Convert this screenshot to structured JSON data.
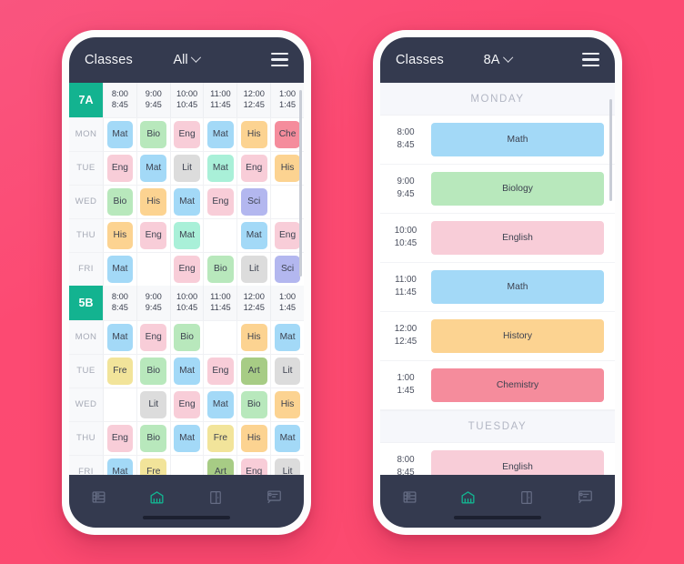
{
  "theme": {
    "background_start": "#f9557f",
    "background_end": "#fc4a6e",
    "topbar_color": "#343a4f",
    "accent_teal": "#13b390",
    "badge_color": "#13b390"
  },
  "subject_colors": {
    "Mat": "#a3d9f7",
    "Math": "#a3d9f7",
    "Bio": "#b8e8bc",
    "Biology": "#b8e8bc",
    "Eng": "#f8cdd8",
    "English": "#f8cdd8",
    "His": "#fcd391",
    "History": "#fcd391",
    "Che": "#f58c9c",
    "Chemistry": "#f58c9c",
    "Lit": "#dcdcdc",
    "Sci": "#b3b7ef",
    "Fre": "#f2e49a",
    "Art": "#a7cc85",
    "MatAlt": "#a9f0d8"
  },
  "phones": [
    {
      "id": "phone-grid",
      "topbar": {
        "title": "Classes",
        "selected_class": "All",
        "menu_icon": "hamburger-icon",
        "caret_icon": "chevron-down-icon"
      },
      "view": "grid",
      "blocks": [
        {
          "badge": "7A",
          "times": [
            {
              "start": "8:00",
              "end": "8:45"
            },
            {
              "start": "9:00",
              "end": "9:45"
            },
            {
              "start": "10:00",
              "end": "10:45"
            },
            {
              "start": "11:00",
              "end": "11:45"
            },
            {
              "start": "12:00",
              "end": "12:45"
            },
            {
              "start": "1:00",
              "end": "1:45"
            }
          ],
          "rows": [
            {
              "day": "MON",
              "slots": [
                {
                  "label": "Mat",
                  "color": "#a3d9f7"
                },
                {
                  "label": "Bio",
                  "color": "#b8e8bc"
                },
                {
                  "label": "Eng",
                  "color": "#f8cdd8"
                },
                {
                  "label": "Mat",
                  "color": "#a3d9f7"
                },
                {
                  "label": "His",
                  "color": "#fcd391"
                },
                {
                  "label": "Che",
                  "color": "#f58c9c"
                }
              ]
            },
            {
              "day": "TUE",
              "slots": [
                {
                  "label": "Eng",
                  "color": "#f8cdd8"
                },
                {
                  "label": "Mat",
                  "color": "#a3d9f7"
                },
                {
                  "label": "Lit",
                  "color": "#dcdcdc"
                },
                {
                  "label": "Mat",
                  "color": "#a9f0d8"
                },
                {
                  "label": "Eng",
                  "color": "#f8cdd8"
                },
                {
                  "label": "His",
                  "color": "#fcd391"
                }
              ]
            },
            {
              "day": "WED",
              "slots": [
                {
                  "label": "Bio",
                  "color": "#b8e8bc"
                },
                {
                  "label": "His",
                  "color": "#fcd391"
                },
                {
                  "label": "Mat",
                  "color": "#a3d9f7"
                },
                {
                  "label": "Eng",
                  "color": "#f8cdd8"
                },
                {
                  "label": "Sci",
                  "color": "#b3b7ef"
                },
                {
                  "label": "",
                  "color": ""
                }
              ]
            },
            {
              "day": "THU",
              "slots": [
                {
                  "label": "His",
                  "color": "#fcd391"
                },
                {
                  "label": "Eng",
                  "color": "#f8cdd8"
                },
                {
                  "label": "Mat",
                  "color": "#a9f0d8"
                },
                {
                  "label": "",
                  "color": ""
                },
                {
                  "label": "Mat",
                  "color": "#a3d9f7"
                },
                {
                  "label": "Eng",
                  "color": "#f8cdd8"
                }
              ]
            },
            {
              "day": "FRI",
              "slots": [
                {
                  "label": "Mat",
                  "color": "#a3d9f7"
                },
                {
                  "label": "",
                  "color": ""
                },
                {
                  "label": "Eng",
                  "color": "#f8cdd8"
                },
                {
                  "label": "Bio",
                  "color": "#b8e8bc"
                },
                {
                  "label": "Lit",
                  "color": "#dcdcdc"
                },
                {
                  "label": "Sci",
                  "color": "#b3b7ef"
                }
              ]
            }
          ]
        },
        {
          "badge": "5B",
          "times": [
            {
              "start": "8:00",
              "end": "8:45"
            },
            {
              "start": "9:00",
              "end": "9:45"
            },
            {
              "start": "10:00",
              "end": "10:45"
            },
            {
              "start": "11:00",
              "end": "11:45"
            },
            {
              "start": "12:00",
              "end": "12:45"
            },
            {
              "start": "1:00",
              "end": "1:45"
            }
          ],
          "rows": [
            {
              "day": "MON",
              "slots": [
                {
                  "label": "Mat",
                  "color": "#a3d9f7"
                },
                {
                  "label": "Eng",
                  "color": "#f8cdd8"
                },
                {
                  "label": "Bio",
                  "color": "#b8e8bc"
                },
                {
                  "label": "",
                  "color": ""
                },
                {
                  "label": "His",
                  "color": "#fcd391"
                },
                {
                  "label": "Mat",
                  "color": "#a3d9f7"
                }
              ]
            },
            {
              "day": "TUE",
              "slots": [
                {
                  "label": "Fre",
                  "color": "#f2e49a"
                },
                {
                  "label": "Bio",
                  "color": "#b8e8bc"
                },
                {
                  "label": "Mat",
                  "color": "#a3d9f7"
                },
                {
                  "label": "Eng",
                  "color": "#f8cdd8"
                },
                {
                  "label": "Art",
                  "color": "#a7cc85"
                },
                {
                  "label": "Lit",
                  "color": "#dcdcdc"
                }
              ]
            },
            {
              "day": "WED",
              "slots": [
                {
                  "label": "",
                  "color": ""
                },
                {
                  "label": "Lit",
                  "color": "#dcdcdc"
                },
                {
                  "label": "Eng",
                  "color": "#f8cdd8"
                },
                {
                  "label": "Mat",
                  "color": "#a3d9f7"
                },
                {
                  "label": "Bio",
                  "color": "#b8e8bc"
                },
                {
                  "label": "His",
                  "color": "#fcd391"
                }
              ]
            },
            {
              "day": "THU",
              "slots": [
                {
                  "label": "Eng",
                  "color": "#f8cdd8"
                },
                {
                  "label": "Bio",
                  "color": "#b8e8bc"
                },
                {
                  "label": "Mat",
                  "color": "#a3d9f7"
                },
                {
                  "label": "Fre",
                  "color": "#f2e49a"
                },
                {
                  "label": "His",
                  "color": "#fcd391"
                },
                {
                  "label": "Mat",
                  "color": "#a3d9f7"
                }
              ]
            },
            {
              "day": "FRI",
              "slots": [
                {
                  "label": "Mat",
                  "color": "#a3d9f7"
                },
                {
                  "label": "Fre",
                  "color": "#f2e49a"
                },
                {
                  "label": "",
                  "color": ""
                },
                {
                  "label": "Art",
                  "color": "#a7cc85"
                },
                {
                  "label": "Eng",
                  "color": "#f8cdd8"
                },
                {
                  "label": "Lit",
                  "color": "#dcdcdc"
                }
              ]
            }
          ]
        }
      ],
      "nav": [
        {
          "icon": "books-icon",
          "active": false
        },
        {
          "icon": "school-building-icon",
          "active": true
        },
        {
          "icon": "door-icon",
          "active": false
        },
        {
          "icon": "teacher-board-icon",
          "active": false
        }
      ]
    },
    {
      "id": "phone-list",
      "topbar": {
        "title": "Classes",
        "selected_class": "8A",
        "menu_icon": "hamburger-icon",
        "caret_icon": "chevron-down-icon"
      },
      "view": "list",
      "days": [
        {
          "name": "MONDAY",
          "lessons": [
            {
              "start": "8:00",
              "end": "8:45",
              "subject": "Math",
              "color": "#a3d9f7"
            },
            {
              "start": "9:00",
              "end": "9:45",
              "subject": "Biology",
              "color": "#b8e8bc"
            },
            {
              "start": "10:00",
              "end": "10:45",
              "subject": "English",
              "color": "#f8cdd8"
            },
            {
              "start": "11:00",
              "end": "11:45",
              "subject": "Math",
              "color": "#a3d9f7"
            },
            {
              "start": "12:00",
              "end": "12:45",
              "subject": "History",
              "color": "#fcd391"
            },
            {
              "start": "1:00",
              "end": "1:45",
              "subject": "Chemistry",
              "color": "#f58c9c"
            }
          ]
        },
        {
          "name": "TUESDAY",
          "lessons": [
            {
              "start": "8:00",
              "end": "8:45",
              "subject": "English",
              "color": "#f8cdd8"
            }
          ]
        }
      ],
      "nav": [
        {
          "icon": "books-icon",
          "active": false
        },
        {
          "icon": "school-building-icon",
          "active": true
        },
        {
          "icon": "door-icon",
          "active": false
        },
        {
          "icon": "teacher-board-icon",
          "active": false
        }
      ]
    }
  ]
}
